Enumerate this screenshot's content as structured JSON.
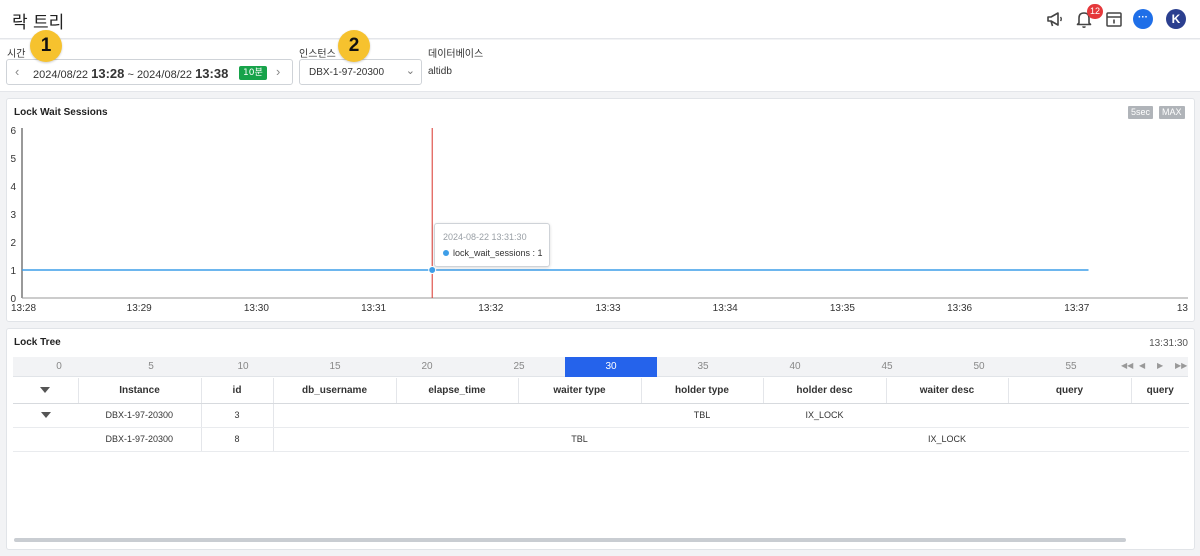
{
  "header": {
    "title": "락 트리",
    "notification_count": "12",
    "avatar_initial": "K",
    "chat_glyph": "···",
    "icons": [
      "megaphone-icon",
      "bell-icon",
      "calendar-icon",
      "chat-icon"
    ]
  },
  "filters": {
    "time_label": "시간",
    "start_date": "2024/08/22",
    "start_time": "13:28",
    "separator": "~",
    "end_date": "2024/08/22",
    "end_time": "13:38",
    "range_badge": "10분",
    "instance_label": "인스턴스",
    "instance_value": "DBX-1-97-20300",
    "database_label": "데이터베이스",
    "database_value": "altidb"
  },
  "callouts": [
    "1",
    "2"
  ],
  "lock_wait_panel": {
    "title": "Lock Wait Sessions",
    "interval_chip": "5sec",
    "agg_chip": "MAX",
    "tooltip_time": "2024-08-22 13:31:30",
    "tooltip_series": "lock_wait_sessions : 1"
  },
  "chart_data": {
    "type": "line",
    "title": "Lock Wait Sessions",
    "x": [
      "13:28",
      "13:29",
      "13:30",
      "13:31",
      "13:32",
      "13:33",
      "13:34",
      "13:35",
      "13:36",
      "13:37",
      "13"
    ],
    "y_ticks": [
      0,
      1,
      2,
      3,
      4,
      5,
      6
    ],
    "ylim": [
      0,
      6
    ],
    "series": [
      {
        "name": "lock_wait_sessions",
        "color": "#3d9ee8",
        "x_start_min": 0,
        "x_end_min": 9.1,
        "value": 1
      }
    ],
    "highlight": {
      "x": "13:31:30",
      "value": 1,
      "line_color": "#d9342b"
    },
    "grid": false
  },
  "lock_tree_panel": {
    "title": "Lock Tree",
    "timestamp": "13:31:30",
    "timeline_labels": [
      "0",
      "5",
      "10",
      "15",
      "20",
      "25",
      "30",
      "35",
      "40",
      "45",
      "50",
      "55"
    ],
    "timeline_active": "30",
    "timeline_nav": [
      "◀◀",
      "◀",
      "▶",
      "▶▶"
    ],
    "columns": [
      "",
      "Instance",
      "id",
      "db_username",
      "elapse_time",
      "waiter type",
      "holder type",
      "holder desc",
      "waiter desc",
      "query",
      "query"
    ],
    "rows": [
      {
        "expanded": true,
        "instance": "DBX-1-97-20300",
        "id": "3",
        "type": "TBL",
        "lock": "IX_LOCK"
      },
      {
        "expanded": false,
        "instance": "DBX-1-97-20300",
        "id": "8",
        "type": "TBL",
        "lock": "IX_LOCK"
      }
    ]
  },
  "colors": {
    "accent": "#2563eb",
    "badge_green": "#17a34a",
    "callout_yellow": "#f6c22e",
    "notification_red": "#e5383b"
  }
}
